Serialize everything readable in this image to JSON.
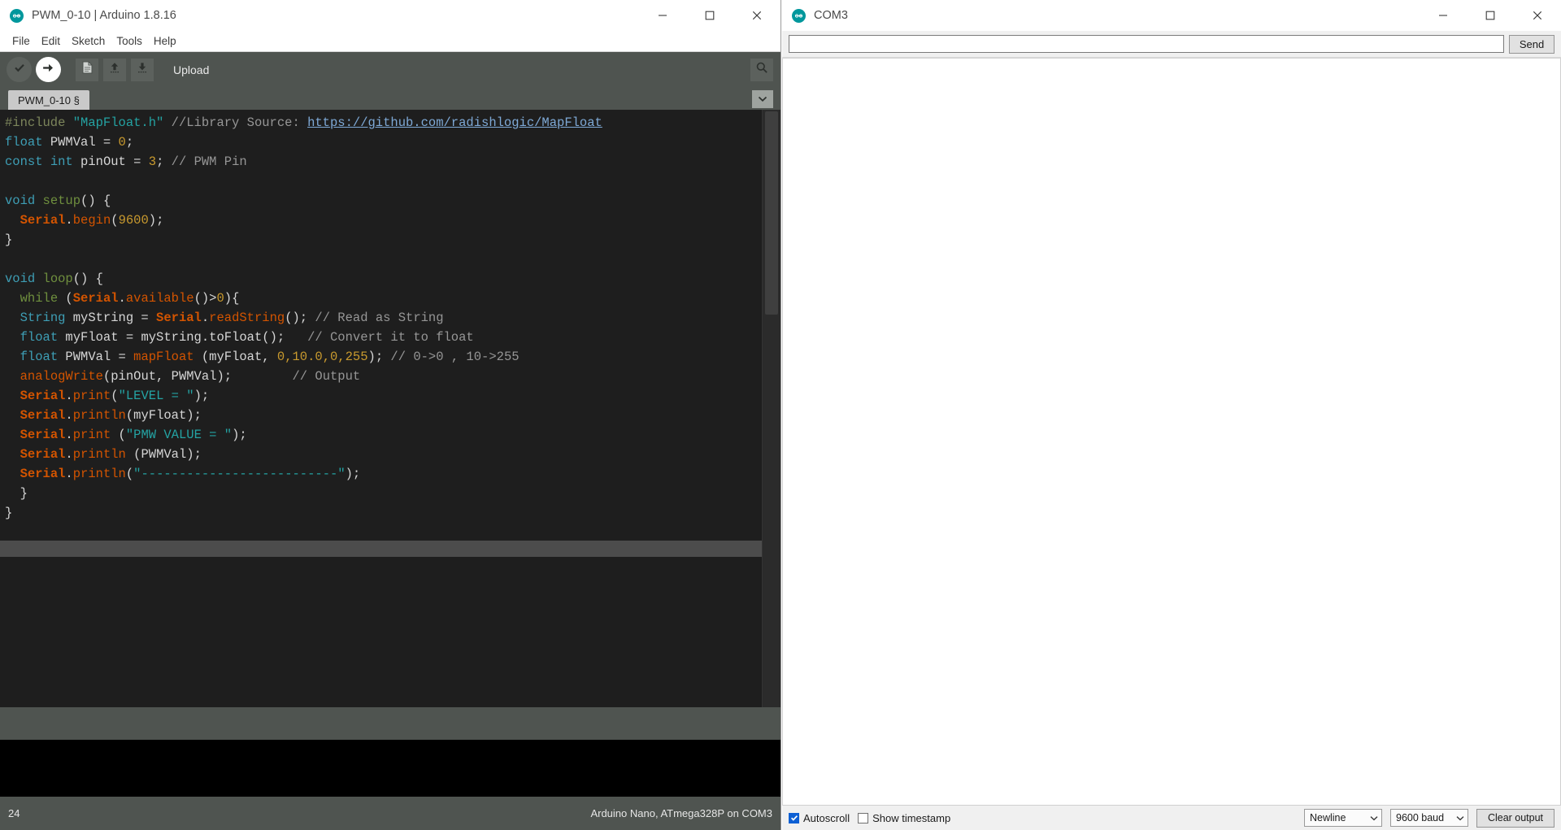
{
  "ide": {
    "title": "PWM_0-10 | Arduino 1.8.16",
    "logo_icon": "arduino-logo-icon",
    "window_controls": {
      "minimize": "minimize-icon",
      "maximize": "maximize-icon",
      "close": "close-icon"
    },
    "menus": [
      {
        "label": "File"
      },
      {
        "label": "Edit"
      },
      {
        "label": "Sketch"
      },
      {
        "label": "Tools"
      },
      {
        "label": "Help"
      }
    ],
    "toolbar": {
      "verify_icon": "check-icon",
      "upload_icon": "arrow-right-icon",
      "new_icon": "new-file-icon",
      "open_icon": "arrow-up-icon",
      "save_icon": "arrow-down-icon",
      "status_label": "Upload",
      "serial_monitor_icon": "magnifier-icon"
    },
    "tab": {
      "label": "PWM_0-10 §",
      "menu_icon": "chevron-down-icon"
    },
    "statusbar": {
      "line_number": "24",
      "board_info": "Arduino Nano, ATmega328P on COM3"
    }
  },
  "code": {
    "lines": [
      [
        {
          "t": "#include ",
          "c": "k-pre"
        },
        {
          "t": "\"MapFloat.h\" ",
          "c": "k-str"
        },
        {
          "t": "//Library Source: ",
          "c": "k-cmt"
        },
        {
          "t": "https://github.com/radishlogic/MapFloat",
          "c": "k-link"
        }
      ],
      [
        {
          "t": "float",
          "c": "k-type"
        },
        {
          "t": " PWMVal = ",
          "c": "k-plain"
        },
        {
          "t": "0",
          "c": "k-num"
        },
        {
          "t": ";",
          "c": "k-plain"
        }
      ],
      [
        {
          "t": "const",
          "c": "k-type"
        },
        {
          "t": " ",
          "c": "k-plain"
        },
        {
          "t": "int",
          "c": "k-type"
        },
        {
          "t": " pinOut = ",
          "c": "k-plain"
        },
        {
          "t": "3",
          "c": "k-num"
        },
        {
          "t": "; ",
          "c": "k-plain"
        },
        {
          "t": "// PWM Pin",
          "c": "k-cmt"
        }
      ],
      [],
      [
        {
          "t": "void",
          "c": "k-type"
        },
        {
          "t": " ",
          "c": "k-plain"
        },
        {
          "t": "setup",
          "c": "k-fn"
        },
        {
          "t": "() {",
          "c": "k-plain"
        }
      ],
      [
        {
          "t": "  ",
          "c": "k-plain"
        },
        {
          "t": "Serial",
          "c": "k-obj"
        },
        {
          "t": ".",
          "c": "k-plain"
        },
        {
          "t": "begin",
          "c": "k-mem"
        },
        {
          "t": "(",
          "c": "k-plain"
        },
        {
          "t": "9600",
          "c": "k-num"
        },
        {
          "t": ");",
          "c": "k-plain"
        }
      ],
      [
        {
          "t": "}",
          "c": "k-plain"
        }
      ],
      [],
      [
        {
          "t": "void",
          "c": "k-type"
        },
        {
          "t": " ",
          "c": "k-plain"
        },
        {
          "t": "loop",
          "c": "k-fn"
        },
        {
          "t": "() {",
          "c": "k-plain"
        }
      ],
      [
        {
          "t": "  ",
          "c": "k-plain"
        },
        {
          "t": "while",
          "c": "k-fn"
        },
        {
          "t": " (",
          "c": "k-plain"
        },
        {
          "t": "Serial",
          "c": "k-obj"
        },
        {
          "t": ".",
          "c": "k-plain"
        },
        {
          "t": "available",
          "c": "k-mem"
        },
        {
          "t": "()>",
          "c": "k-plain"
        },
        {
          "t": "0",
          "c": "k-num"
        },
        {
          "t": "){",
          "c": "k-plain"
        }
      ],
      [
        {
          "t": "  ",
          "c": "k-plain"
        },
        {
          "t": "String",
          "c": "k-type"
        },
        {
          "t": " myString = ",
          "c": "k-plain"
        },
        {
          "t": "Serial",
          "c": "k-obj"
        },
        {
          "t": ".",
          "c": "k-plain"
        },
        {
          "t": "readString",
          "c": "k-mem"
        },
        {
          "t": "(); ",
          "c": "k-plain"
        },
        {
          "t": "// Read as String",
          "c": "k-cmt"
        }
      ],
      [
        {
          "t": "  ",
          "c": "k-plain"
        },
        {
          "t": "float",
          "c": "k-type"
        },
        {
          "t": " myFloat = myString.toFloat();   ",
          "c": "k-plain"
        },
        {
          "t": "// Convert it to float",
          "c": "k-cmt"
        }
      ],
      [
        {
          "t": "  ",
          "c": "k-plain"
        },
        {
          "t": "float",
          "c": "k-type"
        },
        {
          "t": " PWMVal = ",
          "c": "k-plain"
        },
        {
          "t": "mapFloat",
          "c": "k-mem"
        },
        {
          "t": " (myFloat, ",
          "c": "k-plain"
        },
        {
          "t": "0,10.0,0,255",
          "c": "k-num"
        },
        {
          "t": "); ",
          "c": "k-plain"
        },
        {
          "t": "// 0->0 , 10->255",
          "c": "k-cmt"
        }
      ],
      [
        {
          "t": "  ",
          "c": "k-plain"
        },
        {
          "t": "analogWrite",
          "c": "k-mem"
        },
        {
          "t": "(pinOut, PWMVal);        ",
          "c": "k-plain"
        },
        {
          "t": "// Output",
          "c": "k-cmt"
        }
      ],
      [
        {
          "t": "  ",
          "c": "k-plain"
        },
        {
          "t": "Serial",
          "c": "k-obj"
        },
        {
          "t": ".",
          "c": "k-plain"
        },
        {
          "t": "print",
          "c": "k-mem"
        },
        {
          "t": "(",
          "c": "k-plain"
        },
        {
          "t": "\"LEVEL = \"",
          "c": "k-str"
        },
        {
          "t": ");",
          "c": "k-plain"
        }
      ],
      [
        {
          "t": "  ",
          "c": "k-plain"
        },
        {
          "t": "Serial",
          "c": "k-obj"
        },
        {
          "t": ".",
          "c": "k-plain"
        },
        {
          "t": "println",
          "c": "k-mem"
        },
        {
          "t": "(myFloat);",
          "c": "k-plain"
        }
      ],
      [
        {
          "t": "  ",
          "c": "k-plain"
        },
        {
          "t": "Serial",
          "c": "k-obj"
        },
        {
          "t": ".",
          "c": "k-plain"
        },
        {
          "t": "print",
          "c": "k-mem"
        },
        {
          "t": " (",
          "c": "k-plain"
        },
        {
          "t": "\"PMW VALUE = \"",
          "c": "k-str"
        },
        {
          "t": ");",
          "c": "k-plain"
        }
      ],
      [
        {
          "t": "  ",
          "c": "k-plain"
        },
        {
          "t": "Serial",
          "c": "k-obj"
        },
        {
          "t": ".",
          "c": "k-plain"
        },
        {
          "t": "println",
          "c": "k-mem"
        },
        {
          "t": " (PWMVal);",
          "c": "k-plain"
        }
      ],
      [
        {
          "t": "  ",
          "c": "k-plain"
        },
        {
          "t": "Serial",
          "c": "k-obj"
        },
        {
          "t": ".",
          "c": "k-plain"
        },
        {
          "t": "println",
          "c": "k-mem"
        },
        {
          "t": "(",
          "c": "k-plain"
        },
        {
          "t": "\"--------------------------\"",
          "c": "k-str"
        },
        {
          "t": ");",
          "c": "k-plain"
        }
      ],
      [
        {
          "t": "  }",
          "c": "k-plain"
        }
      ],
      [
        {
          "t": "}",
          "c": "k-plain"
        }
      ]
    ]
  },
  "serial_monitor": {
    "title": "COM3",
    "logo_icon": "arduino-logo-icon",
    "window_controls": {
      "minimize": "minimize-icon",
      "maximize": "maximize-icon",
      "close": "close-icon"
    },
    "input_value": "",
    "input_placeholder": "",
    "send_label": "Send",
    "output_text": "",
    "autoscroll": {
      "label": "Autoscroll",
      "checked": true
    },
    "show_timestamp": {
      "label": "Show timestamp",
      "checked": false
    },
    "line_ending": {
      "selected": "Newline"
    },
    "baud_rate": {
      "selected": "9600 baud"
    },
    "clear_output_label": "Clear output"
  },
  "colors": {
    "accent_teal": "#00979c",
    "toolbar_bg": "#4f5450",
    "editor_bg": "#1e1e1e",
    "console_bg": "#000000"
  }
}
